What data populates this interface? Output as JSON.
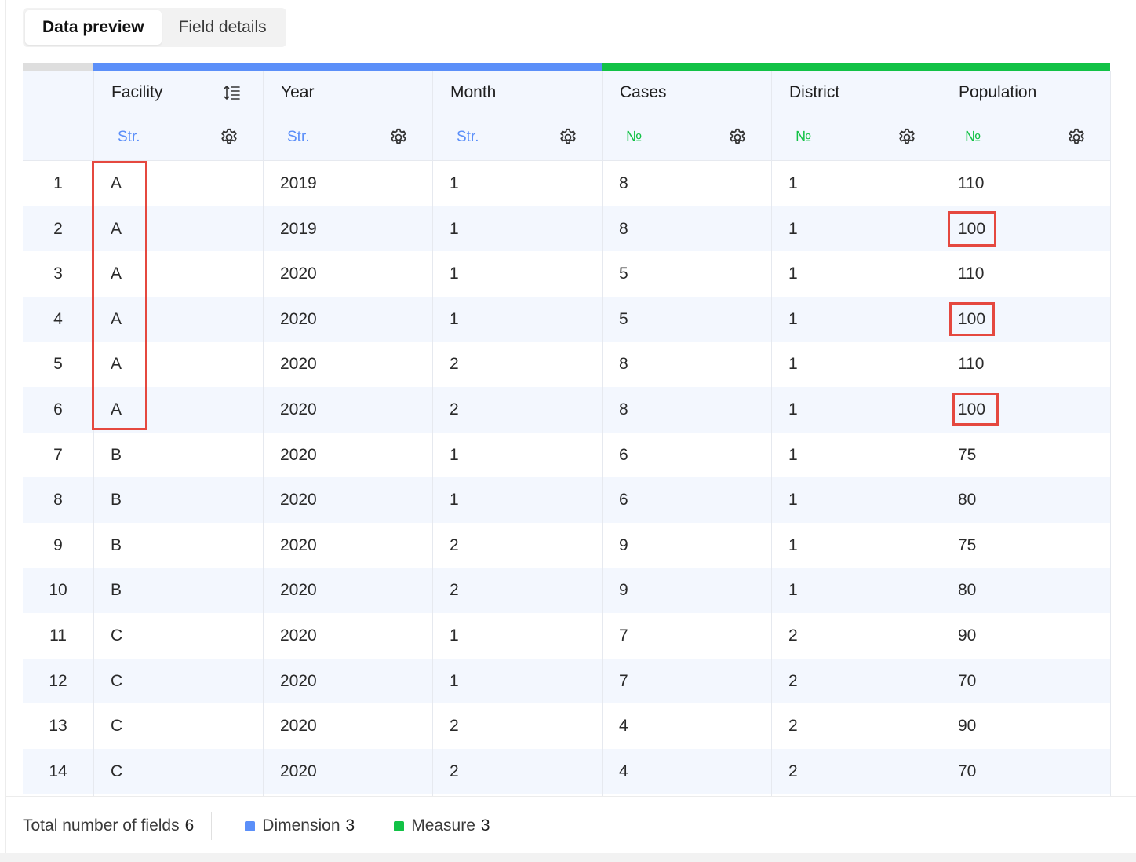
{
  "tabs": [
    {
      "label": "Data preview",
      "active": true
    },
    {
      "label": "Field details",
      "active": false
    }
  ],
  "colors": {
    "dimension": "#5b8ff9",
    "measure": "#12c246",
    "highlight": "#e5483f"
  },
  "columns": [
    {
      "name": "Facility",
      "type": "Str.",
      "kind": "dimension",
      "sort_icon": "sort-icon",
      "settings_icon": "gear-icon"
    },
    {
      "name": "Year",
      "type": "Str.",
      "kind": "dimension",
      "settings_icon": "gear-icon"
    },
    {
      "name": "Month",
      "type": "Str.",
      "kind": "dimension",
      "settings_icon": "gear-icon"
    },
    {
      "name": "Cases",
      "type": "№",
      "kind": "measure",
      "settings_icon": "gear-icon"
    },
    {
      "name": "District",
      "type": "№",
      "kind": "measure",
      "settings_icon": "gear-icon"
    },
    {
      "name": "Population",
      "type": "№",
      "kind": "measure",
      "settings_icon": "gear-icon"
    }
  ],
  "rows": [
    {
      "index": "1",
      "cells": [
        "A",
        "2019",
        "1",
        "8",
        "1",
        "110"
      ]
    },
    {
      "index": "2",
      "cells": [
        "A",
        "2019",
        "1",
        "8",
        "1",
        "100"
      ]
    },
    {
      "index": "3",
      "cells": [
        "A",
        "2020",
        "1",
        "5",
        "1",
        "110"
      ]
    },
    {
      "index": "4",
      "cells": [
        "A",
        "2020",
        "1",
        "5",
        "1",
        "100"
      ]
    },
    {
      "index": "5",
      "cells": [
        "A",
        "2020",
        "2",
        "8",
        "1",
        "110"
      ]
    },
    {
      "index": "6",
      "cells": [
        "A",
        "2020",
        "2",
        "8",
        "1",
        "100"
      ]
    },
    {
      "index": "7",
      "cells": [
        "B",
        "2020",
        "1",
        "6",
        "1",
        "75"
      ]
    },
    {
      "index": "8",
      "cells": [
        "B",
        "2020",
        "1",
        "6",
        "1",
        "80"
      ]
    },
    {
      "index": "9",
      "cells": [
        "B",
        "2020",
        "2",
        "9",
        "1",
        "75"
      ]
    },
    {
      "index": "10",
      "cells": [
        "B",
        "2020",
        "2",
        "9",
        "1",
        "80"
      ]
    },
    {
      "index": "11",
      "cells": [
        "C",
        "2020",
        "1",
        "7",
        "2",
        "90"
      ]
    },
    {
      "index": "12",
      "cells": [
        "C",
        "2020",
        "1",
        "7",
        "2",
        "70"
      ]
    },
    {
      "index": "13",
      "cells": [
        "C",
        "2020",
        "2",
        "4",
        "2",
        "90"
      ]
    },
    {
      "index": "14",
      "cells": [
        "C",
        "2020",
        "2",
        "4",
        "2",
        "70"
      ]
    }
  ],
  "footer": {
    "total_label": "Total number of fields",
    "total_count": "6",
    "dimension_label": "Dimension",
    "dimension_count": "3",
    "measure_label": "Measure",
    "measure_count": "3"
  }
}
